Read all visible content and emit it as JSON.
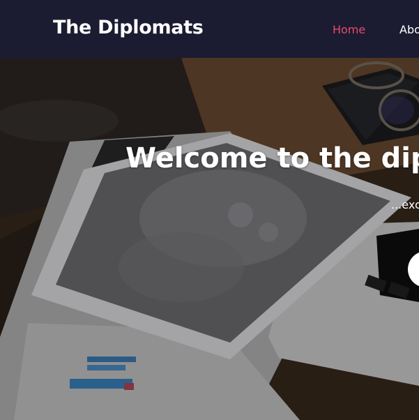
{
  "navbar": {
    "brand": "The Diplomats",
    "links": [
      {
        "label": "Home",
        "active": true
      },
      {
        "label": "Abo"
      }
    ]
  },
  "hero": {
    "title": "Welcome to the diplo",
    "subtitle": "...exc",
    "image": "desk-with-tablet-laptop-glasses-and-charts"
  },
  "colors": {
    "navbar_bg": "#1b1b31",
    "active_link": "#e74b6b",
    "text": "#ffffff"
  }
}
